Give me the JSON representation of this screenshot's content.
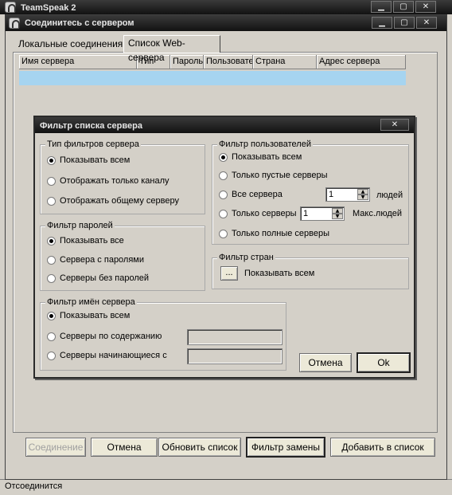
{
  "bg_window": {
    "title": "TeamSpeak 2",
    "status": "Отсоединится"
  },
  "connect_dialog": {
    "title": "Соединитесь с сервером",
    "tabs": [
      {
        "label": "Локальные соединения",
        "active": false
      },
      {
        "label": "Список Web-сервера",
        "active": true
      }
    ],
    "columns": [
      "Имя сервера",
      "Тип",
      "Пароль",
      "Пользователи",
      "Страна",
      "Адрес сервера"
    ],
    "buttons": {
      "connect": "Соединение",
      "cancel": "Отмена",
      "refresh": "Обновить список",
      "filter": "Фильтр замены",
      "add": "Добавить в список"
    }
  },
  "filter_dialog": {
    "title": "Фильтр списка сервера",
    "server_type": {
      "label": "Тип фильтров сервера",
      "options": [
        "Показывать всем",
        "Отображать только каналу",
        "Отображать общему серверу"
      ],
      "selected": 0
    },
    "password": {
      "label": "Фильтр паролей",
      "options": [
        "Показывать все",
        "Сервера с паролями",
        "Серверы  без паролей"
      ],
      "selected": 0
    },
    "users": {
      "label": "Фильтр пользователей",
      "options": [
        "Показывать всем",
        "Только пустые серверы",
        "Все сервера",
        "Только серверы",
        "Только полные серверы"
      ],
      "selected": 0,
      "all_value": "1",
      "all_suffix": "людей",
      "only_value": "1",
      "only_suffix": "Макс.людей"
    },
    "country": {
      "label": "Фильтр стран",
      "button": "...",
      "value": "Показывать всем"
    },
    "name": {
      "label": "Фильтр имён сервера",
      "options": [
        "Показывать всем",
        "Серверы по содержанию",
        "Серверы  начинающиеся с"
      ],
      "selected": 0,
      "contains_value": "",
      "starts_value": ""
    },
    "buttons": {
      "cancel": "Отмена",
      "ok": "Ok"
    }
  },
  "icons": {
    "close": "✕",
    "maximize": "▢",
    "minimize": "▁"
  }
}
